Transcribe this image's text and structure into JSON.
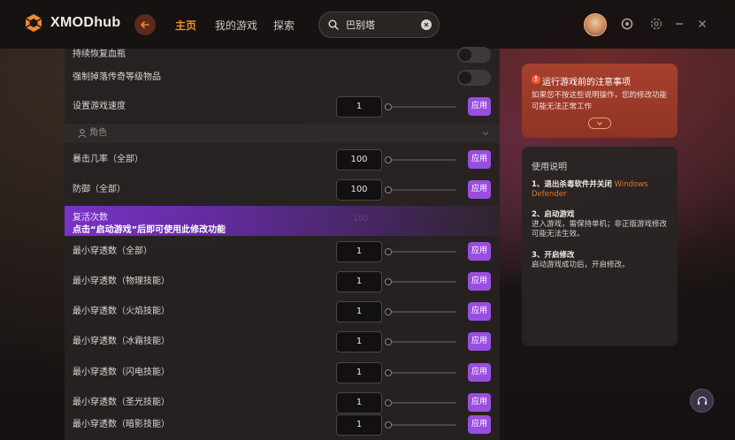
{
  "app": {
    "name": "XMODhub"
  },
  "nav": {
    "tabs": [
      {
        "label": "主页",
        "active": true
      },
      {
        "label": "我的游戏"
      },
      {
        "label": "探索"
      }
    ]
  },
  "search": {
    "value": "巴别塔"
  },
  "colors": {
    "accent": "#f08a2c",
    "apply_button": "#9a4ee0",
    "notice": "#a8402e"
  },
  "settings": {
    "rows_top": [
      {
        "label": "持续恢复血瓶",
        "control": "toggle",
        "on": false
      },
      {
        "label": "强制掉落传奇等级物品",
        "control": "toggle",
        "on": false
      },
      {
        "label": "设置游戏速度",
        "control": "number",
        "value": "1",
        "apply": "应用"
      }
    ],
    "section": {
      "label": "角色"
    },
    "rows_mid": [
      {
        "label": "暴击几率（全部）",
        "value": "100",
        "apply": "应用"
      },
      {
        "label": "防御（全部）",
        "value": "100",
        "apply": "应用"
      }
    ],
    "tooltip": {
      "title": "复活次数",
      "message": "点击“启动游戏”后即可使用此修改功能",
      "ghost_value": "100"
    },
    "rows_bottom": [
      {
        "label": "最小穿透数（全部）",
        "value": "1",
        "apply": "应用"
      },
      {
        "label": "最小穿透数（物理技能）",
        "value": "1",
        "apply": "应用"
      },
      {
        "label": "最小穿透数（火焰技能）",
        "value": "1",
        "apply": "应用"
      },
      {
        "label": "最小穿透数（冰霜技能）",
        "value": "1",
        "apply": "应用"
      },
      {
        "label": "最小穿透数（闪电技能）",
        "value": "1",
        "apply": "应用"
      },
      {
        "label": "最小穿透数（圣光技能）",
        "value": "1",
        "apply": "应用"
      },
      {
        "label": "最小穿透数（暗影技能）",
        "value": "1",
        "apply": "应用"
      }
    ]
  },
  "notice": {
    "icon": "!",
    "title": "运行游戏前的注意事项",
    "text": "如果您不按这些说明操作，您的修改功能可能无法正常工作"
  },
  "guide": {
    "title": "使用说明",
    "steps": [
      {
        "head": "1、退出杀毒软件并关闭",
        "highlight": "Windows Defender",
        "body": ""
      },
      {
        "head": "2、启动游戏",
        "highlight": "",
        "body": "进入游戏，需保持单机；非正版游戏修改可能无法生效。"
      },
      {
        "head": "3、开启修改",
        "highlight": "",
        "body": "启动游戏成功后，开启修改。"
      }
    ]
  }
}
